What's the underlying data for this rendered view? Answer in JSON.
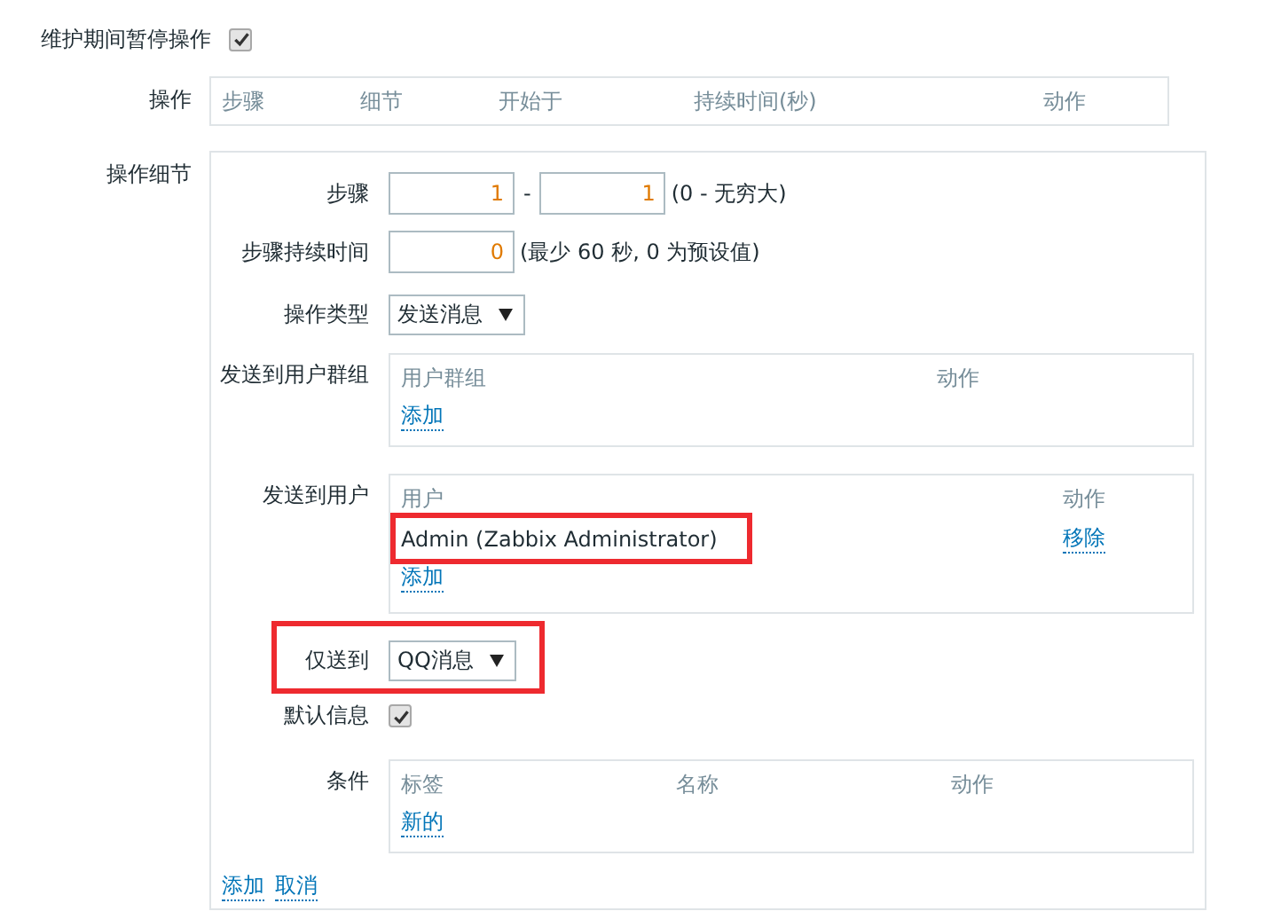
{
  "pause_during_maintenance": {
    "label": "维护期间暂停操作",
    "checked": true
  },
  "operations": {
    "label": "操作",
    "columns": [
      "步骤",
      "细节",
      "开始于",
      "持续时间(秒)",
      "动作"
    ]
  },
  "operation_details": {
    "label": "操作细节",
    "step": {
      "label": "步骤",
      "from": "1",
      "separator": "-",
      "to": "1",
      "hint": "(0 - 无穷大)"
    },
    "step_duration": {
      "label": "步骤持续时间",
      "value": "0",
      "hint": "(最少 60 秒, 0 为预设值)"
    },
    "operation_type": {
      "label": "操作类型",
      "value": "发送消息"
    },
    "send_to_user_groups": {
      "label": "发送到用户群组",
      "columns": [
        "用户群组",
        "动作"
      ],
      "add_link": "添加"
    },
    "send_to_users": {
      "label": "发送到用户",
      "columns": [
        "用户",
        "动作"
      ],
      "rows": [
        {
          "name": "Admin (Zabbix Administrator)",
          "action": "移除",
          "highlighted": true
        }
      ],
      "add_link": "添加"
    },
    "send_only_to": {
      "label": "仅送到",
      "value": "QQ消息",
      "highlighted": true
    },
    "default_message": {
      "label": "默认信息",
      "checked": true
    },
    "conditions": {
      "label": "条件",
      "columns": [
        "标签",
        "名称",
        "动作"
      ],
      "new_link": "新的"
    },
    "actions": [
      "添加",
      "取消"
    ]
  }
}
